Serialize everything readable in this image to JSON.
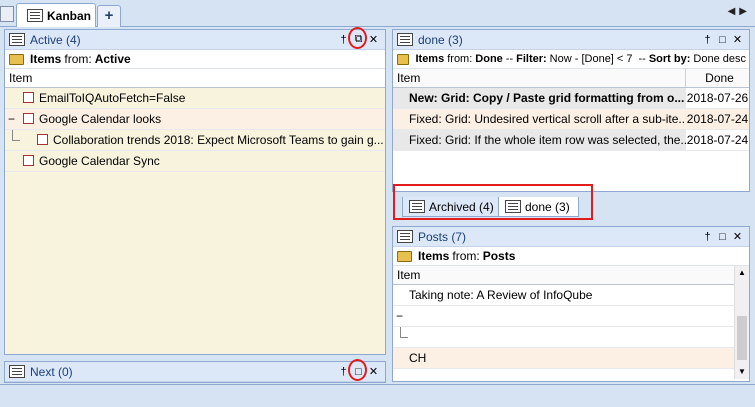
{
  "top_tabs": {
    "kanban_label": "Kanban",
    "add_label": "+",
    "scroll_left": "◀",
    "scroll_right": "▶"
  },
  "active_pane": {
    "title": "Active (4)",
    "items_label": "Items",
    "from_label": "from:",
    "source": "Active",
    "column_item": "Item",
    "rows": [
      {
        "text": "EmailToIQAutoFetch=False"
      },
      {
        "text": "Google Calendar looks"
      },
      {
        "text": "Collaboration trends 2018: Expect Microsoft Teams to gain g..."
      },
      {
        "text": "Google Calendar Sync"
      }
    ],
    "collapse_glyph": "−"
  },
  "next_pane": {
    "title": "Next (0)"
  },
  "done_pane": {
    "title": "done (3)",
    "items_label": "Items",
    "from_label": "from:",
    "source": "Done",
    "filter_sep": "--",
    "filter_label": "Filter:",
    "filter_value": "Now - [Done] < 7",
    "sort_sep": "--",
    "sort_label": "Sort by:",
    "sort_value": "Done desc",
    "column_item": "Item",
    "column_done": "Done",
    "rows": [
      {
        "item": "New: Grid: Copy / Paste grid formatting from o...",
        "done": "2018-07-26"
      },
      {
        "item": "Fixed: Grid: Undesired vertical scroll after a sub-ite...",
        "done": "2018-07-24"
      },
      {
        "item": "Fixed: Grid: If the whole item row was selected, the...",
        "done": "2018-07-24"
      }
    ]
  },
  "bottom_tabs": [
    {
      "label": "Archived (4)"
    },
    {
      "label": "done (3)"
    }
  ],
  "posts_pane": {
    "title": "Posts (7)",
    "items_label": "Items",
    "from_label": "from:",
    "source": "Posts",
    "column_item": "Item",
    "rows": [
      {
        "text": "Taking note: A Review of InfoQube"
      },
      {
        "text": ""
      },
      {
        "text": ""
      },
      {
        "text": "CH"
      }
    ],
    "collapse_glyph": "−"
  },
  "pane_controls": {
    "pin": "†",
    "float": "⧉",
    "maximize": "□",
    "close": "✕"
  },
  "colors": {
    "header_bg": "#dce8f8",
    "active_bg": "#f7f3dc",
    "highlight_row": "#fcefe3",
    "selected_row": "#e8e8e8",
    "annotation_red": "#e21b1b"
  }
}
